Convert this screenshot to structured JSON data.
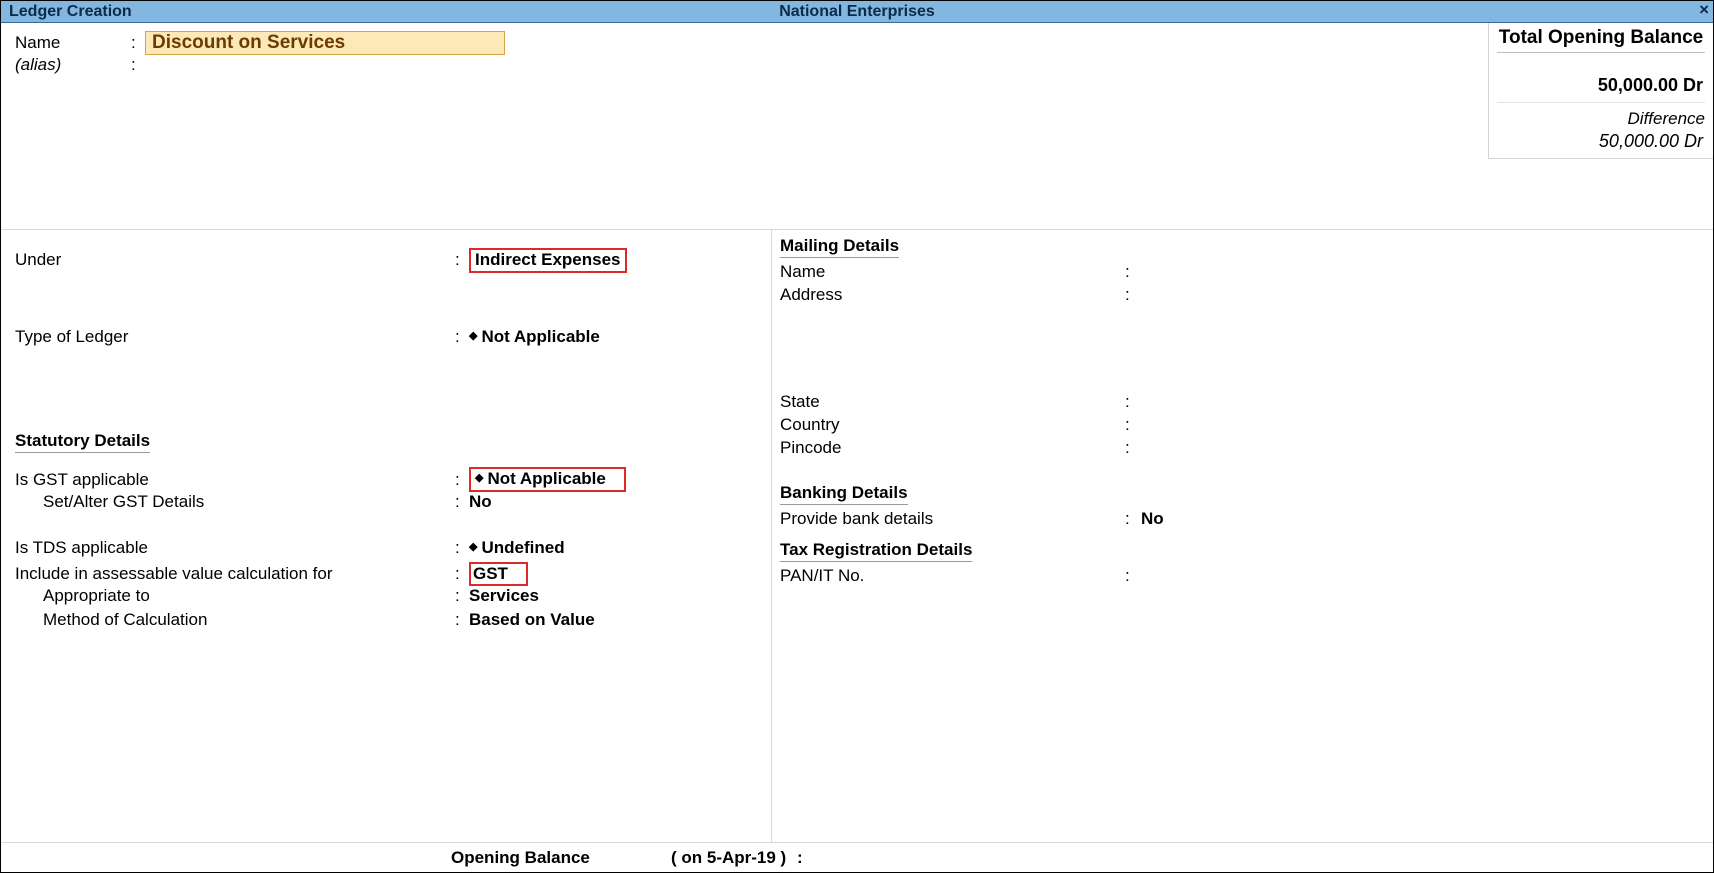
{
  "titlebar": {
    "screen_name": "Ledger Creation",
    "company_name": "National Enterprises",
    "close_glyph": "×"
  },
  "header": {
    "name_label": "Name",
    "name_value": "Discount on Services",
    "alias_label": "(alias)"
  },
  "balance": {
    "title": "Total Opening Balance",
    "amount": "50,000.00 Dr",
    "diff_label": "Difference",
    "diff_amount": "50,000.00 Dr"
  },
  "left": {
    "under_label": "Under",
    "under_value": "Indirect Expenses",
    "type_label": "Type of Ledger",
    "type_value": "Not Applicable",
    "stat_heading": "Statutory Details",
    "gst_app_label": "Is GST applicable",
    "gst_app_value": "Not Applicable",
    "setalter_label": "Set/Alter GST Details",
    "setalter_value": "No",
    "tds_label": "Is TDS applicable",
    "tds_value": "Undefined",
    "include_label": "Include in assessable value calculation for",
    "include_value": "GST",
    "appr_label": "Appropriate to",
    "appr_value": "Services",
    "method_label": "Method of Calculation",
    "method_value": "Based on Value"
  },
  "right": {
    "mailing_heading": "Mailing Details",
    "name_label": "Name",
    "address_label": "Address",
    "state_label": "State",
    "country_label": "Country",
    "pincode_label": "Pincode",
    "banking_heading": "Banking Details",
    "provide_bank_label": "Provide bank details",
    "provide_bank_value": "No",
    "tax_heading": "Tax Registration Details",
    "pan_label": "PAN/IT No."
  },
  "footer": {
    "ob_label": "Opening Balance",
    "ob_date": "( on 5-Apr-19 )"
  }
}
